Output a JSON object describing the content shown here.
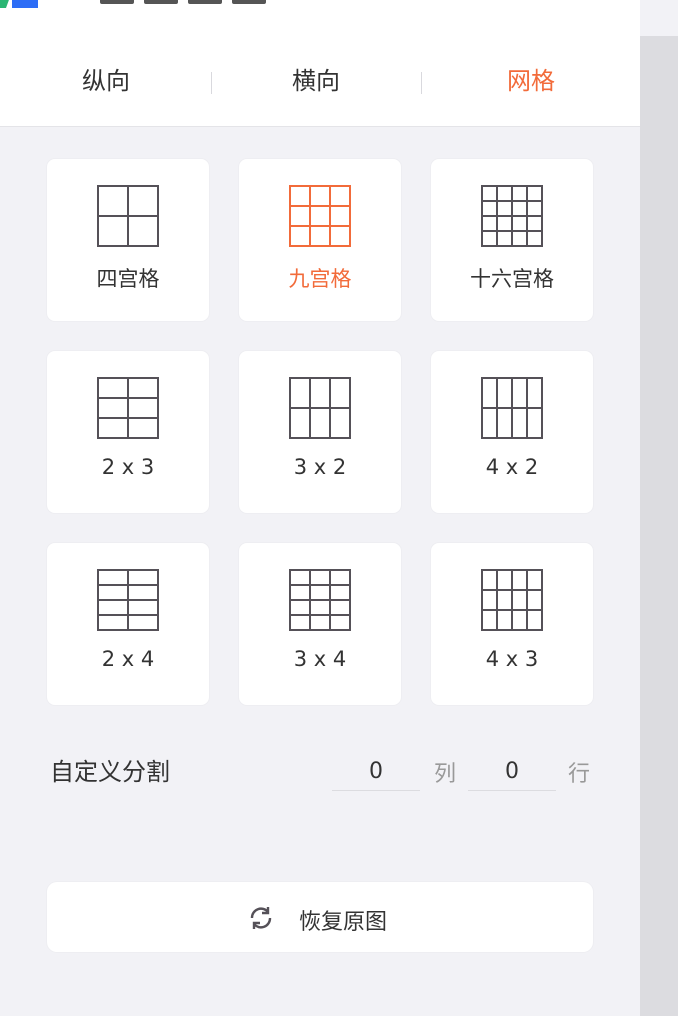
{
  "tabs": [
    {
      "label": "纵向",
      "active": false
    },
    {
      "label": "横向",
      "active": false
    },
    {
      "label": "网格",
      "active": true
    }
  ],
  "grid_options": [
    {
      "label": "四宫格",
      "cols": 2,
      "rows": 2,
      "selected": false
    },
    {
      "label": "九宫格",
      "cols": 3,
      "rows": 3,
      "selected": true
    },
    {
      "label": "十六宫格",
      "cols": 4,
      "rows": 4,
      "selected": false
    },
    {
      "label": "2 x 3",
      "cols": 2,
      "rows": 3,
      "selected": false
    },
    {
      "label": "3 x 2",
      "cols": 3,
      "rows": 2,
      "selected": false
    },
    {
      "label": "4 x 2",
      "cols": 4,
      "rows": 2,
      "selected": false
    },
    {
      "label": "2 x 4",
      "cols": 2,
      "rows": 4,
      "selected": false
    },
    {
      "label": "3 x 4",
      "cols": 3,
      "rows": 4,
      "selected": false
    },
    {
      "label": "4 x 3",
      "cols": 4,
      "rows": 3,
      "selected": false
    }
  ],
  "custom_split": {
    "label": "自定义分割",
    "columns_value": "0",
    "columns_unit": "列",
    "rows_value": "0",
    "rows_unit": "行"
  },
  "restore": {
    "label": "恢复原图",
    "icon": "refresh-icon"
  },
  "colors": {
    "accent": "#f26b3a",
    "icon_stroke": "#555158",
    "background": "#f2f2f6",
    "card": "#ffffff"
  }
}
